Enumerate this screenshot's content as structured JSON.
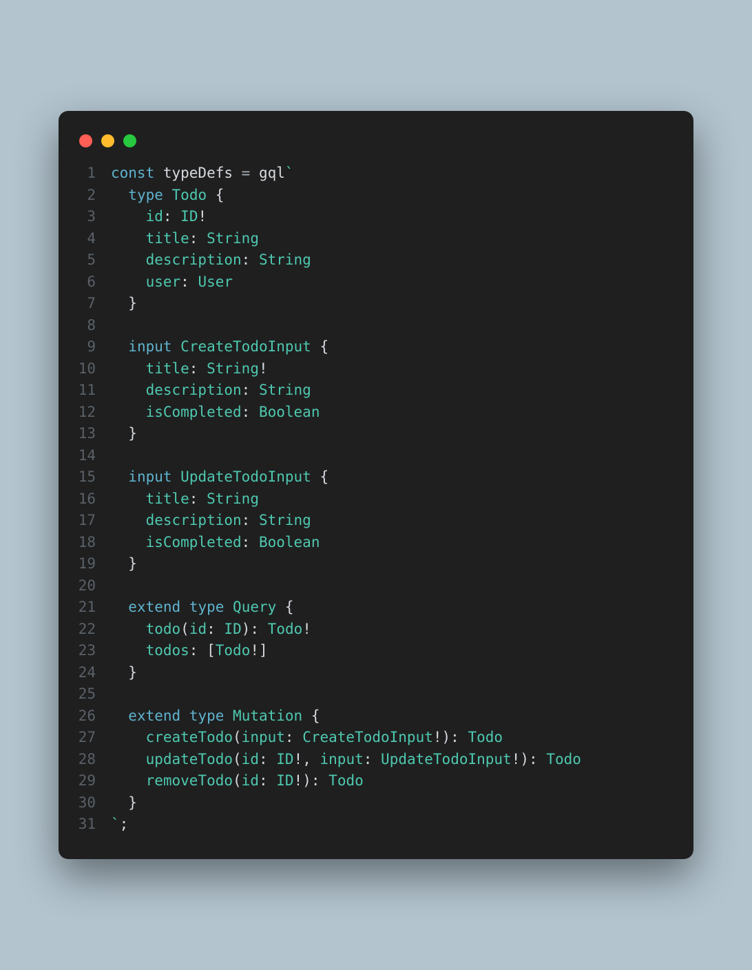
{
  "traffic_lights": [
    "close",
    "minimize",
    "maximize"
  ],
  "lines": [
    {
      "n": "1",
      "tokens": [
        [
          "kw",
          "const "
        ],
        [
          "fn",
          "typeDefs"
        ],
        [
          "op",
          " = "
        ],
        [
          "fn",
          "gql"
        ],
        [
          "str",
          "`"
        ]
      ]
    },
    {
      "n": "2",
      "tokens": [
        [
          "str",
          "  "
        ],
        [
          "kw",
          "type"
        ],
        [
          "str",
          " "
        ],
        [
          "ty",
          "Todo"
        ],
        [
          "str",
          " "
        ],
        [
          "punct",
          "{"
        ]
      ]
    },
    {
      "n": "3",
      "tokens": [
        [
          "str",
          "    id"
        ],
        [
          "punct",
          ":"
        ],
        [
          "str",
          " "
        ],
        [
          "ty",
          "ID"
        ],
        [
          "punct",
          "!"
        ]
      ]
    },
    {
      "n": "4",
      "tokens": [
        [
          "str",
          "    title"
        ],
        [
          "punct",
          ":"
        ],
        [
          "str",
          " "
        ],
        [
          "ty",
          "String"
        ]
      ]
    },
    {
      "n": "5",
      "tokens": [
        [
          "str",
          "    description"
        ],
        [
          "punct",
          ":"
        ],
        [
          "str",
          " "
        ],
        [
          "ty",
          "String"
        ]
      ]
    },
    {
      "n": "6",
      "tokens": [
        [
          "str",
          "    user"
        ],
        [
          "punct",
          ":"
        ],
        [
          "str",
          " "
        ],
        [
          "ty",
          "User"
        ]
      ]
    },
    {
      "n": "7",
      "tokens": [
        [
          "str",
          "  "
        ],
        [
          "punct",
          "}"
        ]
      ]
    },
    {
      "n": "8",
      "tokens": [
        [
          "str",
          " "
        ]
      ]
    },
    {
      "n": "9",
      "tokens": [
        [
          "str",
          "  "
        ],
        [
          "kw",
          "input"
        ],
        [
          "str",
          " "
        ],
        [
          "ty",
          "CreateTodoInput"
        ],
        [
          "str",
          " "
        ],
        [
          "punct",
          "{"
        ]
      ]
    },
    {
      "n": "10",
      "tokens": [
        [
          "str",
          "    title"
        ],
        [
          "punct",
          ":"
        ],
        [
          "str",
          " "
        ],
        [
          "ty",
          "String"
        ],
        [
          "punct",
          "!"
        ]
      ]
    },
    {
      "n": "11",
      "tokens": [
        [
          "str",
          "    description"
        ],
        [
          "punct",
          ":"
        ],
        [
          "str",
          " "
        ],
        [
          "ty",
          "String"
        ]
      ]
    },
    {
      "n": "12",
      "tokens": [
        [
          "str",
          "    isCompleted"
        ],
        [
          "punct",
          ":"
        ],
        [
          "str",
          " "
        ],
        [
          "ty",
          "Boolean"
        ]
      ]
    },
    {
      "n": "13",
      "tokens": [
        [
          "str",
          "  "
        ],
        [
          "punct",
          "}"
        ]
      ]
    },
    {
      "n": "14",
      "tokens": [
        [
          "str",
          " "
        ]
      ]
    },
    {
      "n": "15",
      "tokens": [
        [
          "str",
          "  "
        ],
        [
          "kw",
          "input"
        ],
        [
          "str",
          " "
        ],
        [
          "ty",
          "UpdateTodoInput"
        ],
        [
          "str",
          " "
        ],
        [
          "punct",
          "{"
        ]
      ]
    },
    {
      "n": "16",
      "tokens": [
        [
          "str",
          "    title"
        ],
        [
          "punct",
          ":"
        ],
        [
          "str",
          " "
        ],
        [
          "ty",
          "String"
        ]
      ]
    },
    {
      "n": "17",
      "tokens": [
        [
          "str",
          "    description"
        ],
        [
          "punct",
          ":"
        ],
        [
          "str",
          " "
        ],
        [
          "ty",
          "String"
        ]
      ]
    },
    {
      "n": "18",
      "tokens": [
        [
          "str",
          "    isCompleted"
        ],
        [
          "punct",
          ":"
        ],
        [
          "str",
          " "
        ],
        [
          "ty",
          "Boolean"
        ]
      ]
    },
    {
      "n": "19",
      "tokens": [
        [
          "str",
          "  "
        ],
        [
          "punct",
          "}"
        ]
      ]
    },
    {
      "n": "20",
      "tokens": [
        [
          "str",
          " "
        ]
      ]
    },
    {
      "n": "21",
      "tokens": [
        [
          "str",
          "  "
        ],
        [
          "kw",
          "extend"
        ],
        [
          "str",
          " "
        ],
        [
          "kw",
          "type"
        ],
        [
          "str",
          " "
        ],
        [
          "ty",
          "Query"
        ],
        [
          "str",
          " "
        ],
        [
          "punct",
          "{"
        ]
      ]
    },
    {
      "n": "22",
      "tokens": [
        [
          "str",
          "    todo"
        ],
        [
          "punct",
          "("
        ],
        [
          "str",
          "id"
        ],
        [
          "punct",
          ":"
        ],
        [
          "str",
          " "
        ],
        [
          "ty",
          "ID"
        ],
        [
          "punct",
          "):"
        ],
        [
          "str",
          " "
        ],
        [
          "ty",
          "Todo"
        ],
        [
          "punct",
          "!"
        ]
      ]
    },
    {
      "n": "23",
      "tokens": [
        [
          "str",
          "    todos"
        ],
        [
          "punct",
          ":"
        ],
        [
          "str",
          " "
        ],
        [
          "punct",
          "["
        ],
        [
          "ty",
          "Todo"
        ],
        [
          "punct",
          "!"
        ],
        [
          "punct",
          "]"
        ]
      ]
    },
    {
      "n": "24",
      "tokens": [
        [
          "str",
          "  "
        ],
        [
          "punct",
          "}"
        ]
      ]
    },
    {
      "n": "25",
      "tokens": [
        [
          "str",
          " "
        ]
      ]
    },
    {
      "n": "26",
      "tokens": [
        [
          "str",
          "  "
        ],
        [
          "kw",
          "extend"
        ],
        [
          "str",
          " "
        ],
        [
          "kw",
          "type"
        ],
        [
          "str",
          " "
        ],
        [
          "ty",
          "Mutation"
        ],
        [
          "str",
          " "
        ],
        [
          "punct",
          "{"
        ]
      ]
    },
    {
      "n": "27",
      "tokens": [
        [
          "str",
          "    createTodo"
        ],
        [
          "punct",
          "("
        ],
        [
          "str",
          "input"
        ],
        [
          "punct",
          ":"
        ],
        [
          "str",
          " "
        ],
        [
          "ty",
          "CreateTodoInput"
        ],
        [
          "punct",
          "!):"
        ],
        [
          "str",
          " "
        ],
        [
          "ty",
          "Todo"
        ]
      ]
    },
    {
      "n": "28",
      "tokens": [
        [
          "str",
          "    updateTodo"
        ],
        [
          "punct",
          "("
        ],
        [
          "str",
          "id"
        ],
        [
          "punct",
          ":"
        ],
        [
          "str",
          " "
        ],
        [
          "ty",
          "ID"
        ],
        [
          "punct",
          "!,"
        ],
        [
          "str",
          " input"
        ],
        [
          "punct",
          ":"
        ],
        [
          "str",
          " "
        ],
        [
          "ty",
          "UpdateTodoInput"
        ],
        [
          "punct",
          "!):"
        ],
        [
          "str",
          " "
        ],
        [
          "ty",
          "Todo"
        ]
      ]
    },
    {
      "n": "29",
      "tokens": [
        [
          "str",
          "    removeTodo"
        ],
        [
          "punct",
          "("
        ],
        [
          "str",
          "id"
        ],
        [
          "punct",
          ":"
        ],
        [
          "str",
          " "
        ],
        [
          "ty",
          "ID"
        ],
        [
          "punct",
          "!):"
        ],
        [
          "str",
          " "
        ],
        [
          "ty",
          "Todo"
        ]
      ]
    },
    {
      "n": "30",
      "tokens": [
        [
          "str",
          "  "
        ],
        [
          "punct",
          "}"
        ]
      ]
    },
    {
      "n": "31",
      "tokens": [
        [
          "str",
          "`"
        ],
        [
          "punct",
          ";"
        ]
      ]
    }
  ]
}
